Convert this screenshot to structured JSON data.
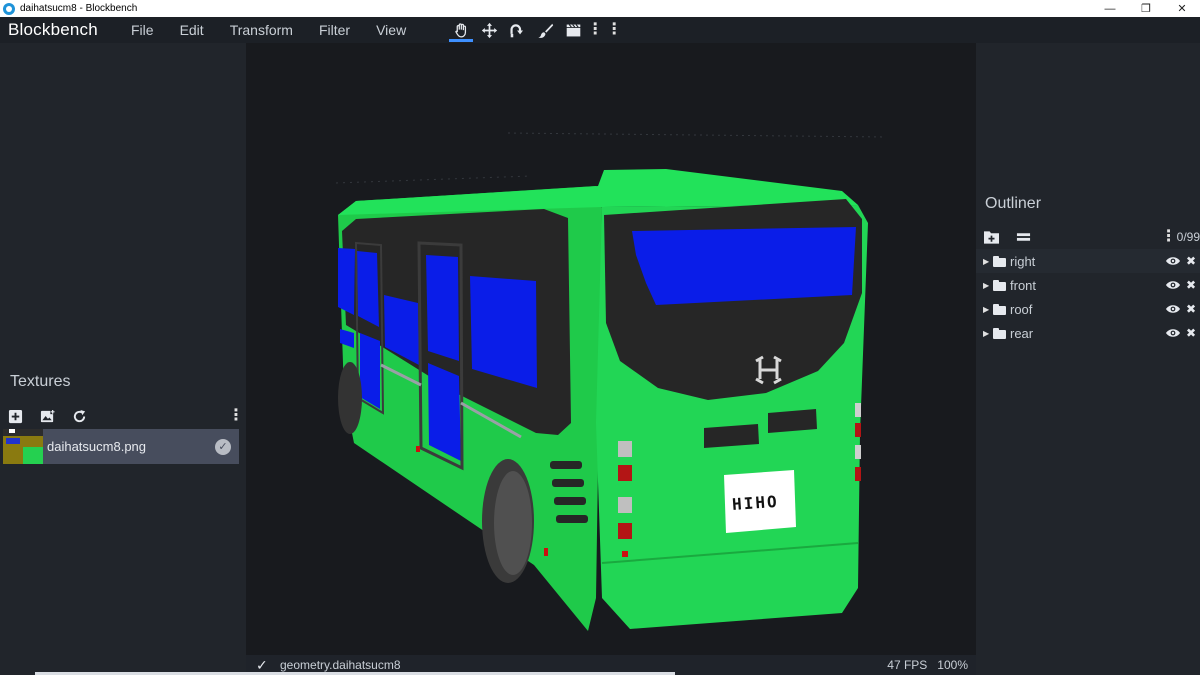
{
  "window": {
    "title": "daihatsucm8 - Blockbench",
    "minimize": "—",
    "restore": "❐",
    "close": "✕"
  },
  "app": {
    "brand": "Blockbench",
    "menu": [
      "File",
      "Edit",
      "Transform",
      "Filter",
      "View"
    ]
  },
  "toolbar": {
    "tools": [
      "hand-tool",
      "move-tool",
      "rotate-tool",
      "paint-tool",
      "clapper-tool"
    ],
    "active_tool": "hand-tool",
    "more": "⋮"
  },
  "textures": {
    "title": "Textures",
    "more": "⋮",
    "items": [
      {
        "name": "daihatsucm8.png",
        "check": "✓"
      }
    ]
  },
  "outliner": {
    "title": "Outliner",
    "count": "0/99",
    "more": "⋮",
    "groups": [
      {
        "label": "right",
        "caret": "▶",
        "close": "✖"
      },
      {
        "label": "front",
        "caret": "▶",
        "close": "✖"
      },
      {
        "label": "roof",
        "caret": "▶",
        "close": "✖"
      },
      {
        "label": "rear",
        "caret": "▶",
        "close": "✖"
      }
    ]
  },
  "viewport": {
    "plate_text": "HIHO"
  },
  "status": {
    "check": "✓",
    "geometry": "geometry.daihatsucm8",
    "fps": "47 FPS",
    "zoom": "100%"
  },
  "colors": {
    "accent": "#3e90ff",
    "bus_body": "#20d050",
    "bus_window": "#0a1de8",
    "bus_dark": "#262626"
  }
}
